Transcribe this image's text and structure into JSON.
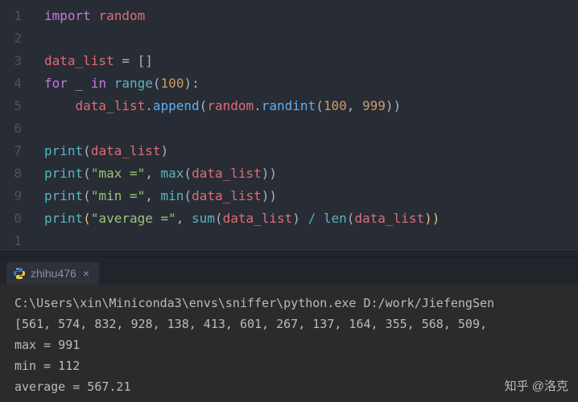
{
  "editor": {
    "gutter": [
      "1",
      "2",
      "3",
      "4",
      "5",
      "6",
      "7",
      "8",
      "9",
      "0",
      "1"
    ],
    "code": {
      "l1_kw": "import",
      "l1_mod": "random",
      "l3_var": "data_list",
      "l3_eq": " = ",
      "l3_br": "[]",
      "l4_for": "for",
      "l4_us": "_",
      "l4_in": "in",
      "l4_range": "range",
      "l4_lp": "(",
      "l4_num": "100",
      "l4_rp": "):",
      "l5_obj": "data_list",
      "l5_dot1": ".",
      "l5_app": "append",
      "l5_lp": "(",
      "l5_rand": "random",
      "l5_dot2": ".",
      "l5_ri": "randint",
      "l5_lp2": "(",
      "l5_a": "100",
      "l5_c": ", ",
      "l5_b": "999",
      "l5_rp2": "))",
      "l7_print": "print",
      "l7_lp": "(",
      "l7_arg": "data_list",
      "l7_rp": ")",
      "l8_print": "print",
      "l8_lp": "(",
      "l8_str": "\"max =\"",
      "l8_c": ", ",
      "l8_max": "max",
      "l8_lp2": "(",
      "l8_arg": "data_list",
      "l8_rp": "))",
      "l9_print": "print",
      "l9_lp": "(",
      "l9_str": "\"min =\"",
      "l9_c": ", ",
      "l9_min": "min",
      "l9_lp2": "(",
      "l9_arg": "data_list",
      "l9_rp": "))",
      "l10_print": "print",
      "l10_lp": "(",
      "l10_str": "\"average =\"",
      "l10_c": ", ",
      "l10_sum": "sum",
      "l10_lp2": "(",
      "l10_arg1": "data_list",
      "l10_rp2": ") ",
      "l10_div": "/",
      "l10_sp": " ",
      "l10_len": "len",
      "l10_lp3": "(",
      "l10_arg2": "data_list",
      "l10_rp": "))"
    }
  },
  "tab": {
    "label": "zhihu476",
    "close": "×"
  },
  "terminal": {
    "line1": "C:\\Users\\xin\\Miniconda3\\envs\\sniffer\\python.exe D:/work/JiefengSen",
    "line2": "[561, 574, 832, 928, 138, 413, 601, 267, 137, 164, 355, 568, 509, ",
    "line3": "max = 991",
    "line4": "min = 112",
    "line5": "average = 567.21"
  },
  "watermark": "知乎 @洛克"
}
